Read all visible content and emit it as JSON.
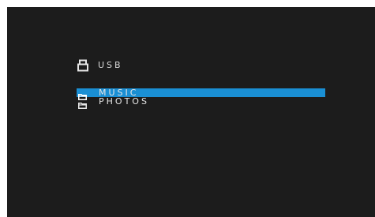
{
  "device": {
    "icon": "usb-drive-icon",
    "label": "USB"
  },
  "folders": [
    {
      "label": "MUSIC",
      "icon": "folder-icon",
      "selected": true
    },
    {
      "label": "PHOTOS",
      "icon": "folder-icon",
      "selected": false
    }
  ],
  "colors": {
    "background": "#1c1c1c",
    "selection": "#1a8fd4",
    "text": "#e6e6e6"
  }
}
